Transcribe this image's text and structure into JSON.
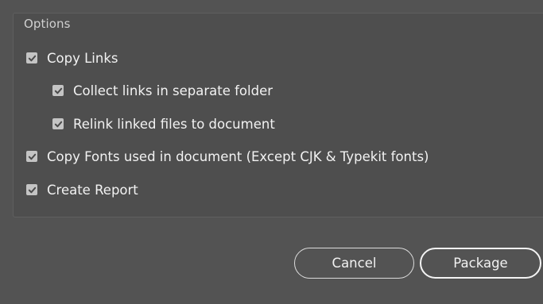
{
  "options": {
    "title": "Options",
    "items": [
      {
        "label": "Copy Links",
        "checked": true
      },
      {
        "label": "Collect links in separate folder",
        "checked": true
      },
      {
        "label": "Relink linked files to document",
        "checked": true
      },
      {
        "label": "Copy Fonts used in document (Except CJK & Typekit fonts)",
        "checked": true
      },
      {
        "label": "Create Report",
        "checked": true
      }
    ]
  },
  "buttons": {
    "cancel_label": "Cancel",
    "package_label": "Package"
  },
  "colors": {
    "background": "#535353",
    "checkbox": "#c4c4c4",
    "checkmark": "#4a4a4a"
  }
}
